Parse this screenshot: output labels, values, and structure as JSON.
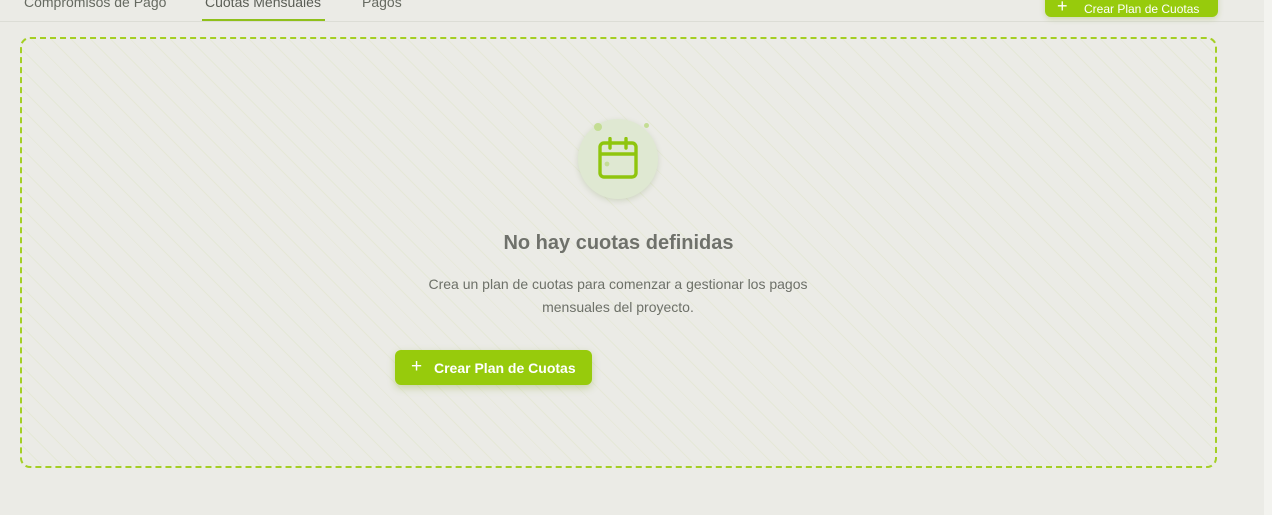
{
  "tabs": [
    {
      "label": "Compromisos de Pago",
      "active": false
    },
    {
      "label": "Cuotas Mensuales",
      "active": true
    },
    {
      "label": "Pagos",
      "active": false
    }
  ],
  "header": {
    "create_button_label": "Crear Plan de Cuotas"
  },
  "empty_state": {
    "icon": "calendar-icon",
    "title": "No hay cuotas definidas",
    "description": "Crea un plan de cuotas para comenzar a gestionar los pagos mensuales del proyecto.",
    "button_label": "Crear Plan de Cuotas"
  },
  "colors": {
    "accent": "#97cb0c",
    "background": "#ebebe6",
    "icon_circle": "#dfe8d2"
  }
}
